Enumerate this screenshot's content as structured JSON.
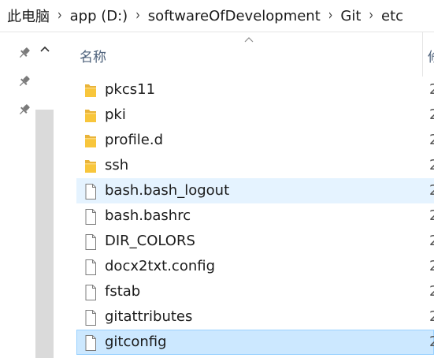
{
  "address": {
    "segments": [
      "此电脑",
      "app (D:)",
      "softwareOfDevelopment",
      "Git",
      "etc"
    ],
    "separator": "›"
  },
  "header": {
    "name_label": "名称",
    "next_label": "修"
  },
  "files": [
    {
      "name": "pkcs11",
      "type": "folder",
      "col2": "2",
      "state": "normal"
    },
    {
      "name": "pki",
      "type": "folder",
      "col2": "2",
      "state": "normal"
    },
    {
      "name": "profile.d",
      "type": "folder",
      "col2": "2",
      "state": "normal"
    },
    {
      "name": "ssh",
      "type": "folder",
      "col2": "2",
      "state": "normal"
    },
    {
      "name": "bash.bash_logout",
      "type": "file",
      "col2": "2",
      "state": "hover"
    },
    {
      "name": "bash.bashrc",
      "type": "file",
      "col2": "2",
      "state": "normal"
    },
    {
      "name": "DIR_COLORS",
      "type": "file",
      "col2": "2",
      "state": "normal"
    },
    {
      "name": "docx2txt.config",
      "type": "file",
      "col2": "2",
      "state": "normal"
    },
    {
      "name": "fstab",
      "type": "file",
      "col2": "2",
      "state": "normal"
    },
    {
      "name": "gitattributes",
      "type": "file",
      "col2": "2",
      "state": "normal"
    },
    {
      "name": "gitconfig",
      "type": "file",
      "col2": "2",
      "state": "selected"
    }
  ],
  "colors": {
    "hover": "#e5f3ff",
    "selected": "#cce8ff",
    "selected_border": "#99d1ff",
    "folder": "#f8c63c"
  }
}
